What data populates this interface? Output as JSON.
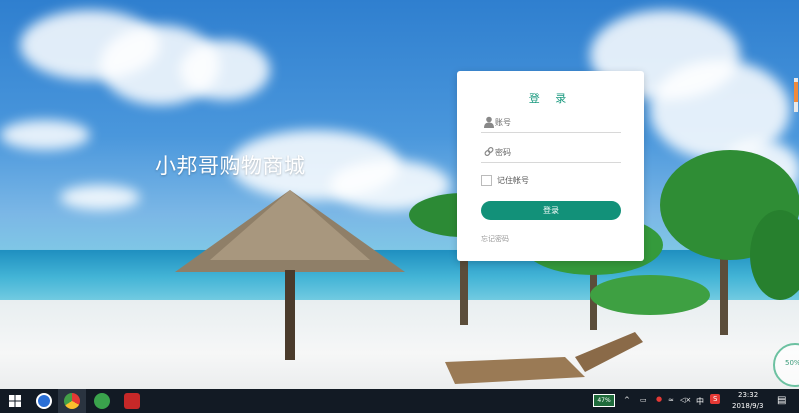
{
  "page": {
    "brand_title": "小邦哥购物商城"
  },
  "login": {
    "title": "登 录",
    "username_placeholder": "账号",
    "password_placeholder": "密码",
    "remember_label": "记住帐号",
    "submit_label": "登录",
    "forgot_link": "忘记密码",
    "accent_color": "#129179"
  },
  "widgets": {
    "gauge_value": "50%"
  },
  "taskbar": {
    "pinned": [
      {
        "name": "start",
        "icon": "windows-logo-icon"
      },
      {
        "name": "sogou-browser",
        "icon": "sogou-icon"
      },
      {
        "name": "chrome",
        "icon": "chrome-icon"
      },
      {
        "name": "hbuilder",
        "icon": "hbuilder-icon"
      },
      {
        "name": "editor",
        "icon": "editor-icon"
      }
    ],
    "battery_percent": "47%",
    "ime_label": "中",
    "time": "23:32",
    "date": "2018/9/3"
  }
}
